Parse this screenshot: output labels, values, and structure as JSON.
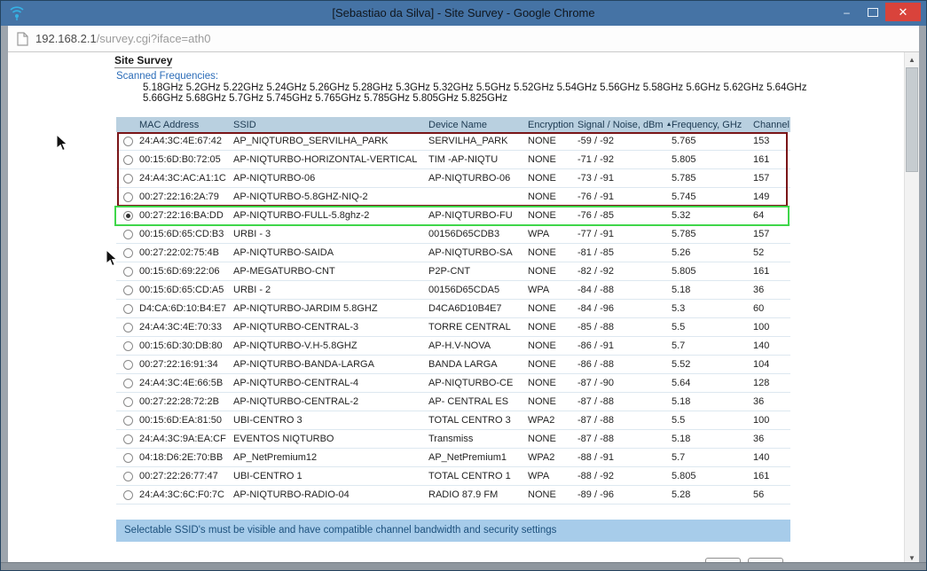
{
  "window": {
    "title": "[Sebastiao da Silva] - Site Survey - Google Chrome",
    "minimize_glyph": "–",
    "close_glyph": "✕"
  },
  "address_bar": {
    "host": "192.168.2.1",
    "path": "/survey.cgi?iface=ath0"
  },
  "page": {
    "heading": "Site Survey",
    "scanned_frequencies_label": "Scanned Frequencies:",
    "frequencies_line1": "5.18GHz 5.2GHz 5.22GHz 5.24GHz 5.26GHz 5.28GHz 5.3GHz 5.32GHz 5.5GHz 5.52GHz 5.54GHz 5.56GHz 5.58GHz 5.6GHz 5.62GHz 5.64GHz",
    "frequencies_line2": "5.66GHz 5.68GHz 5.7GHz 5.745GHz 5.765GHz 5.785GHz 5.805GHz 5.825GHz",
    "info_bar": "Selectable SSID's must be visible and have compatible channel bandwidth and security settings"
  },
  "table": {
    "headers": [
      "MAC Address",
      "SSID",
      "Device Name",
      "Encryption",
      "Signal / Noise, dBm",
      "Frequency, GHz",
      "Channel"
    ],
    "sorted_column": "Signal / Noise, dBm",
    "sort_arrow": "▲",
    "rows": [
      {
        "mac": "24:A4:3C:4E:67:42",
        "ssid": "AP_NIQTURBO_SERVILHA_PARK",
        "device": "SERVILHA_PARK",
        "encryption": "NONE",
        "signal": "-59 / -92",
        "frequency": "5.765",
        "channel": "153",
        "selected": false
      },
      {
        "mac": "00:15:6D:B0:72:05",
        "ssid": "AP-NIQTURBO-HORIZONTAL-VERTICAL",
        "device": "TIM -AP-NIQTU",
        "encryption": "NONE",
        "signal": "-71 / -92",
        "frequency": "5.805",
        "channel": "161",
        "selected": false
      },
      {
        "mac": "24:A4:3C:AC:A1:1C",
        "ssid": "AP-NIQTURBO-06",
        "device": "AP-NIQTURBO-06",
        "encryption": "NONE",
        "signal": "-73 / -91",
        "frequency": "5.785",
        "channel": "157",
        "selected": false
      },
      {
        "mac": "00:27:22:16:2A:79",
        "ssid": "AP-NIQTURBO-5.8GHZ-NIQ-2",
        "device": "",
        "encryption": "NONE",
        "signal": "-76 / -91",
        "frequency": "5.745",
        "channel": "149",
        "selected": false
      },
      {
        "mac": "00:27:22:16:BA:DD",
        "ssid": "AP-NIQTURBO-FULL-5.8ghz-2",
        "device": "AP-NIQTURBO-FU",
        "encryption": "NONE",
        "signal": "-76 / -85",
        "frequency": "5.32",
        "channel": "64",
        "selected": true
      },
      {
        "mac": "00:15:6D:65:CD:B3",
        "ssid": "URBI - 3",
        "device": "00156D65CDB3",
        "encryption": "WPA",
        "signal": "-77 / -91",
        "frequency": "5.785",
        "channel": "157",
        "selected": false
      },
      {
        "mac": "00:27:22:02:75:4B",
        "ssid": "AP-NIQTURBO-SAIDA",
        "device": "AP-NIQTURBO-SA",
        "encryption": "NONE",
        "signal": "-81 / -85",
        "frequency": "5.26",
        "channel": "52",
        "selected": false
      },
      {
        "mac": "00:15:6D:69:22:06",
        "ssid": "AP-MEGATURBO-CNT",
        "device": "P2P-CNT",
        "encryption": "NONE",
        "signal": "-82 / -92",
        "frequency": "5.805",
        "channel": "161",
        "selected": false
      },
      {
        "mac": "00:15:6D:65:CD:A5",
        "ssid": "URBI - 2",
        "device": "00156D65CDA5",
        "encryption": "WPA",
        "signal": "-84 / -88",
        "frequency": "5.18",
        "channel": "36",
        "selected": false
      },
      {
        "mac": "D4:CA:6D:10:B4:E7",
        "ssid": "AP-NIQTURBO-JARDIM 5.8GHZ",
        "device": "D4CA6D10B4E7",
        "encryption": "NONE",
        "signal": "-84 / -96",
        "frequency": "5.3",
        "channel": "60",
        "selected": false
      },
      {
        "mac": "24:A4:3C:4E:70:33",
        "ssid": "AP-NIQTURBO-CENTRAL-3",
        "device": "TORRE CENTRAL",
        "encryption": "NONE",
        "signal": "-85 / -88",
        "frequency": "5.5",
        "channel": "100",
        "selected": false
      },
      {
        "mac": "00:15:6D:30:DB:80",
        "ssid": "AP-NIQTURBO-V.H-5.8GHZ",
        "device": "AP-H.V-NOVA",
        "encryption": "NONE",
        "signal": "-86 / -91",
        "frequency": "5.7",
        "channel": "140",
        "selected": false
      },
      {
        "mac": "00:27:22:16:91:34",
        "ssid": "AP-NIQTURBO-BANDA-LARGA",
        "device": "BANDA LARGA",
        "encryption": "NONE",
        "signal": "-86 / -88",
        "frequency": "5.52",
        "channel": "104",
        "selected": false
      },
      {
        "mac": "24:A4:3C:4E:66:5B",
        "ssid": "AP-NIQTURBO-CENTRAL-4",
        "device": "AP-NIQTURBO-CE",
        "encryption": "NONE",
        "signal": "-87 / -90",
        "frequency": "5.64",
        "channel": "128",
        "selected": false
      },
      {
        "mac": "00:27:22:28:72:2B",
        "ssid": "AP-NIQTURBO-CENTRAL-2",
        "device": "AP- CENTRAL ES",
        "encryption": "NONE",
        "signal": "-87 / -88",
        "frequency": "5.18",
        "channel": "36",
        "selected": false
      },
      {
        "mac": "00:15:6D:EA:81:50",
        "ssid": "UBI-CENTRO 3",
        "device": "TOTAL CENTRO 3",
        "encryption": "WPA2",
        "signal": "-87 / -88",
        "frequency": "5.5",
        "channel": "100",
        "selected": false
      },
      {
        "mac": "24:A4:3C:9A:EA:CF",
        "ssid": "EVENTOS NIQTURBO",
        "device": "Transmiss",
        "encryption": "NONE",
        "signal": "-87 / -88",
        "frequency": "5.18",
        "channel": "36",
        "selected": false
      },
      {
        "mac": "04:18:D6:2E:70:BB",
        "ssid": "AP_NetPremium12",
        "device": "AP_NetPremium1",
        "encryption": "WPA2",
        "signal": "-88 / -91",
        "frequency": "5.7",
        "channel": "140",
        "selected": false
      },
      {
        "mac": "00:27:22:26:77:47",
        "ssid": "UBI-CENTRO 1",
        "device": "TOTAL CENTRO 1",
        "encryption": "WPA",
        "signal": "-88 / -92",
        "frequency": "5.805",
        "channel": "161",
        "selected": false
      },
      {
        "mac": "24:A4:3C:6C:F0:7C",
        "ssid": "AP-NIQTURBO-RADIO-04",
        "device": "RADIO 87.9 FM",
        "encryption": "NONE",
        "signal": "-89 / -96",
        "frequency": "5.28",
        "channel": "56",
        "selected": false
      }
    ]
  },
  "annotations": {
    "red_box_color": "#7a1518",
    "red_box_rows": "rows 1-4",
    "green_box_color": "#3fd64a",
    "green_box_rows": "row 5 (selected)"
  },
  "colors": {
    "titlebar": "#4573A5",
    "close_button": "#D9433B",
    "table_header_bg": "#B9D0E0",
    "info_bar_bg": "#A7CCEA",
    "link_blue": "#2B6CB8"
  }
}
